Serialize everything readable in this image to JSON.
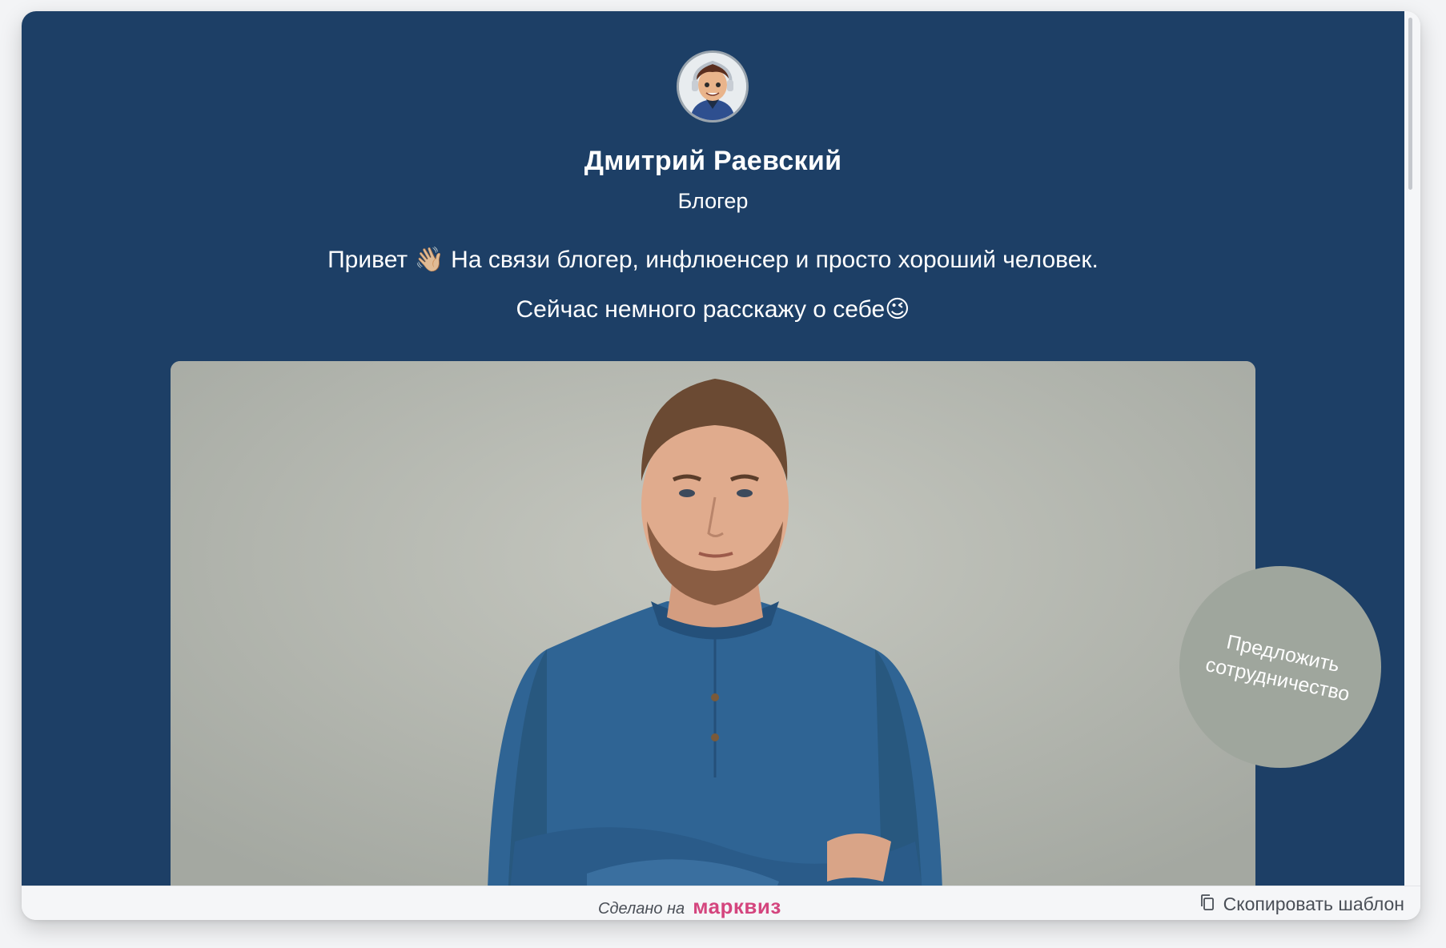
{
  "profile": {
    "name": "Дмитрий Раевский",
    "role": "Блогер"
  },
  "bio": {
    "line1": "Привет 👋🏼 На связи блогер, инфлюенсер и просто хороший человек.",
    "line2": "Сейчас немного расскажу о себе😉"
  },
  "cta": {
    "label": "Предложить сотрудничество"
  },
  "footer": {
    "made_on": "Сделано на",
    "brand": "марквиз",
    "copy_template": "Скопировать шаблон"
  },
  "colors": {
    "page_background": "#1d3f66",
    "cta_background": "#9fa69d",
    "brand": "#d4457e",
    "footer_background": "#f5f6f8"
  },
  "icons": {
    "copy": "copy-icon",
    "avatar": "cartoon-avatar-with-headphones",
    "photo": "portrait-man-blue-shirt"
  }
}
